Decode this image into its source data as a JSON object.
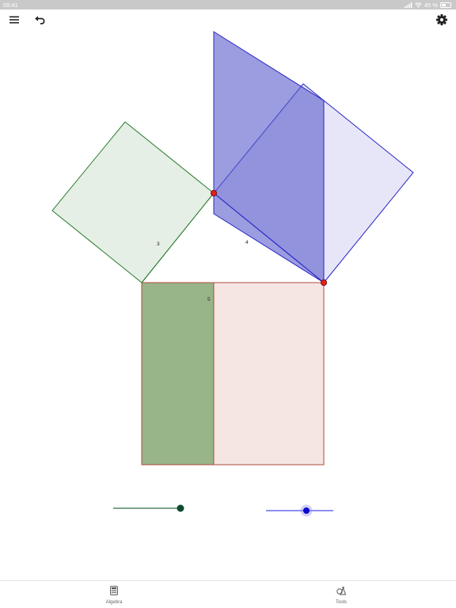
{
  "status_bar": {
    "time": "09:41",
    "battery_percent_label": "45 %",
    "battery_level": 0.45,
    "icons": [
      "signal-icon",
      "wifi-icon",
      "battery-icon"
    ]
  },
  "toolbar": {
    "menu_icon": "menu-icon",
    "undo_icon": "undo-icon",
    "settings_icon": "gear-icon"
  },
  "construction": {
    "side_labels": {
      "a": "3",
      "b": "4",
      "c": "5"
    },
    "colors": {
      "square_a_fill": "#e5efe5",
      "square_a_stroke": "#2e7d32",
      "square_b_fill": "#5a5acc",
      "square_b_stroke": "#2727c4",
      "square_b_copy_fill": "#e6e6f8",
      "square_c_fill": "#f5e6e4",
      "square_c_stroke": "#b0483c",
      "square_c_left_fill": "#98b589",
      "point_color": "#e0221a"
    }
  },
  "sliders": [
    {
      "name": "slider-a",
      "value": 1.0,
      "track_color": "#7fa38a",
      "thumb_color": "#0f4a2c"
    },
    {
      "name": "slider-b",
      "value": 0.6,
      "track_color": "#8e8ef2",
      "thumb_color": "#0a0ad0"
    }
  ],
  "bottom_nav": {
    "tabs": [
      {
        "label": "Algebra",
        "icon": "calculator-icon"
      },
      {
        "label": "Tools",
        "icon": "tools-icon"
      }
    ]
  }
}
